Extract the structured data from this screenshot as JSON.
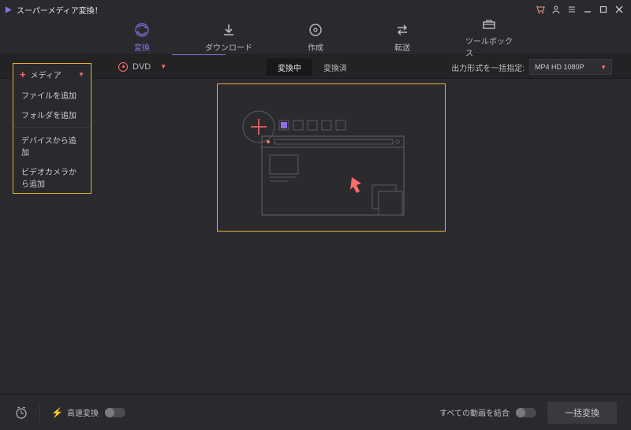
{
  "titlebar": {
    "app_name": "スーパーメディア変換！"
  },
  "nav": {
    "items": [
      {
        "label": "変換"
      },
      {
        "label": "ダウンロード"
      },
      {
        "label": "作成"
      },
      {
        "label": "転送"
      },
      {
        "label": "ツールボックス"
      }
    ]
  },
  "toolbar": {
    "media_label": "メディア",
    "dvd_label": "DVD"
  },
  "tabs": {
    "converting": "変換中",
    "converted": "変換済"
  },
  "output": {
    "label": "出力形式を一括指定:",
    "value": "MP4 HD 1080P"
  },
  "menu": {
    "header": "メディア",
    "items": [
      "ファイルを追加",
      "フォルダを追加",
      "デバイスから追加",
      "ビデオカメラから追加"
    ]
  },
  "footer": {
    "fast_label": "高速変換",
    "merge_label": "すべての動画を結合",
    "batch_label": "一括変換"
  }
}
